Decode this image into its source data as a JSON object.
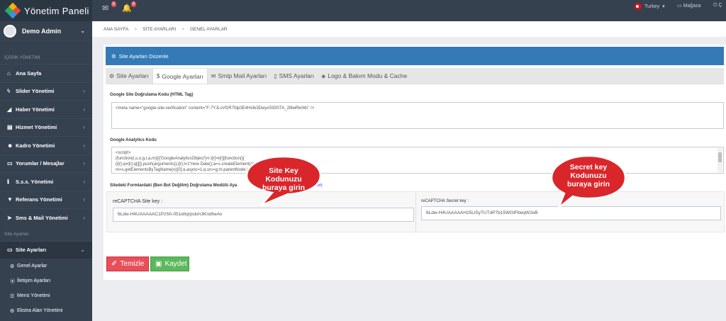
{
  "app": {
    "title": "Yönetim Paneli"
  },
  "topbar": {
    "mail_badge": "8",
    "bell_badge": "8",
    "language": "Turkey",
    "store_label": "Mağaza",
    "exit_label": "Ç"
  },
  "user": {
    "name": "Demo Admin"
  },
  "sidebar": {
    "content_heading": "İÇERİK YÖNETİMİ",
    "items": [
      {
        "label": "Ana Sayfa",
        "icon": "home-icon"
      },
      {
        "label": "Slider Yönetimi",
        "icon": "bolt-icon"
      },
      {
        "label": "Haber Yönetimi",
        "icon": "bullhorn-icon"
      },
      {
        "label": "Hizmet Yönetimi",
        "icon": "briefcase-icon"
      },
      {
        "label": "Kadro Yönetimi",
        "icon": "users-icon"
      },
      {
        "label": "Yorumlar / Mesajlar",
        "icon": "inbox-icon"
      },
      {
        "label": "S.s.s. Yönetimi",
        "icon": "info-icon"
      },
      {
        "label": "Referans Yönetimi",
        "icon": "bookmark-icon"
      },
      {
        "label": "Sms & Mail Yönetimi",
        "icon": "send-icon"
      }
    ],
    "settings_heading": "Site Ayarları",
    "active_item": {
      "label": "Site Ayarları",
      "icon": "monitor-icon"
    },
    "sub_items": [
      {
        "label": "Genel Ayarlar",
        "icon": "cogs-icon"
      },
      {
        "label": "İletişim Ayarları",
        "icon": "map-marker-icon"
      },
      {
        "label": "Menü Yönetimi",
        "icon": "menu-icon"
      },
      {
        "label": "Ekstra Alan Yönetimi",
        "icon": "cogs-icon"
      }
    ]
  },
  "breadcrumb": {
    "items": [
      "ANA SAYFA",
      "SİTE AYARLARI",
      "GENEL AYARLAR"
    ],
    "separator": ">"
  },
  "panel": {
    "title": "Site Ayarları Düzenle",
    "tabs": [
      {
        "label": "Site Ayarları",
        "icon": "cog-icon"
      },
      {
        "label": "Google Ayarları",
        "icon": "dollar-icon"
      },
      {
        "label": "Smtp Mail Ayarları",
        "icon": "envelope-icon"
      },
      {
        "label": "SMS Ayarları",
        "icon": "mobile-icon"
      },
      {
        "label": "Logo & Bakım Modu & Cache",
        "icon": "cube-icon"
      }
    ],
    "active_tab": 1,
    "verification_label": "Google Site Doğrulama Kodu (HTML Tag)",
    "verification_value": "<meta name=\"google-site-verification\" content=\"F-7YJLsVfzR7fdp3E4Hxfe3DwyxS93STA_2l8wRkrMs\" />",
    "analytics_label": "Google Analytics Kodu",
    "analytics_lines": [
      "<script>",
      "  (function(i,s,o,g,r,a,m){i['GoogleAnalyticsObject']=r;i[r]=i[r]||function(){",
      "  (i[r].q=i[r].q||[]).push(arguments)},i[r].l=1*new Date();a=s.createElement(o),",
      "  m=s.getElementsByTagName(o)[0];a.async=1;a.src=g;m.parentNode.insertBefore(a,m)"
    ],
    "recaptcha_heading": "Sitedeki Formlardaki (Ben Bot Değilim) Doğrulama Modülü Aya",
    "recaptcha_heading_link": "Aktif)",
    "site_key_label": "reCAPTCHA Site key :",
    "site_key_value": "6Ldw-H4UAAAAAC1PzSh-051elIqrpckm3KndheAv",
    "secret_key_label": "reCAPTCHA Secret key :",
    "secret_key_value": "6Ldw-H4UAAAAAH25LlSyTUTdP7b15WGtFbeqW2eB",
    "clear_label": "Temizle",
    "save_label": "Kaydet"
  },
  "callouts": {
    "site_key": "Site Key Kodunuzu buraya girin",
    "secret_key": "Secret key Kodunuzu buraya girin"
  },
  "colors": {
    "topbar": "#364150",
    "sidebar": "#364150",
    "panel_header": "#337ab7",
    "clear_button": "#e7505a",
    "save_button": "#5cb85c",
    "callout": "#d9262b"
  }
}
